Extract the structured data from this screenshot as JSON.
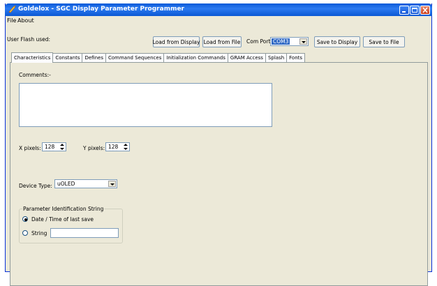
{
  "window": {
    "title": "Goldelox - SGC Display Parameter Programmer"
  },
  "menu": [
    "File",
    "About"
  ],
  "toolbar": {
    "user_flash_label": "User Flash used:",
    "load_display": "Load from Display",
    "load_file": "Load from File",
    "com_port_label": "Com Port:",
    "com_port_value": "COM3",
    "save_display": "Save to Display",
    "save_file": "Save to File"
  },
  "tabs": [
    "Characteristics",
    "Constants",
    "Defines",
    "Command Sequences",
    "Initialization Commands",
    "GRAM Access",
    "Splash",
    "Fonts"
  ],
  "form": {
    "comments_label": "Comments:-",
    "comments_value": "",
    "x_pixels_label": "X pixels:",
    "x_pixels_value": "128",
    "y_pixels_label": "Y pixels:",
    "y_pixels_value": "128",
    "device_type_label": "Device Type:",
    "device_type_value": "uOLED",
    "param_group_title": "Parameter Identification String",
    "radio_date": "Date / Time of last save",
    "radio_string": "String",
    "string_value": ""
  }
}
